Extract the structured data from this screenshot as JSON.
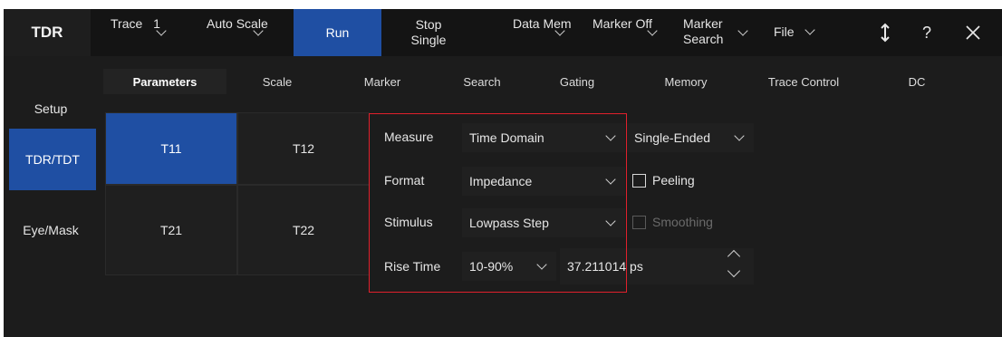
{
  "colors": {
    "accent": "#1f4fa3",
    "highlight": "#e0202c",
    "background": "#1c1c1c"
  },
  "toolbar": {
    "title": "TDR",
    "trace": {
      "line1": "Trace",
      "line2": "1"
    },
    "auto_scale": {
      "line1": "Auto",
      "line2": "Scale"
    },
    "run": "Run",
    "stop": {
      "line1": "Stop",
      "line2": "Single"
    },
    "data_mem": {
      "line1": "Data",
      "line2": "Mem"
    },
    "marker_off": {
      "line1": "Marker",
      "line2": "Off"
    },
    "marker_search": {
      "line1": "Marker",
      "line2": "Search"
    },
    "file": "File",
    "icons": {
      "resize": "updown-arrow-icon",
      "help": "?",
      "close": "close-icon"
    }
  },
  "sidebar": {
    "items": [
      {
        "label": "Setup"
      },
      {
        "label": "TDR/TDT"
      },
      {
        "label": "Eye/Mask"
      }
    ]
  },
  "tabs": [
    "Parameters",
    "Scale",
    "Marker",
    "Search",
    "Gating",
    "Memory",
    "Trace Control",
    "DC"
  ],
  "params": {
    "grid": [
      "T11",
      "T12",
      "T21",
      "T22"
    ],
    "measure": {
      "label": "Measure",
      "value": "Time Domain",
      "mode": "Single-Ended"
    },
    "format": {
      "label": "Format",
      "value": "Impedance",
      "checkbox": "Peeling"
    },
    "stimulus": {
      "label": "Stimulus",
      "value": "Lowpass Step",
      "checkbox": "Smoothing"
    },
    "rise_time": {
      "label": "Rise Time",
      "value": "10-90%",
      "number": "37.211014 ps"
    }
  }
}
